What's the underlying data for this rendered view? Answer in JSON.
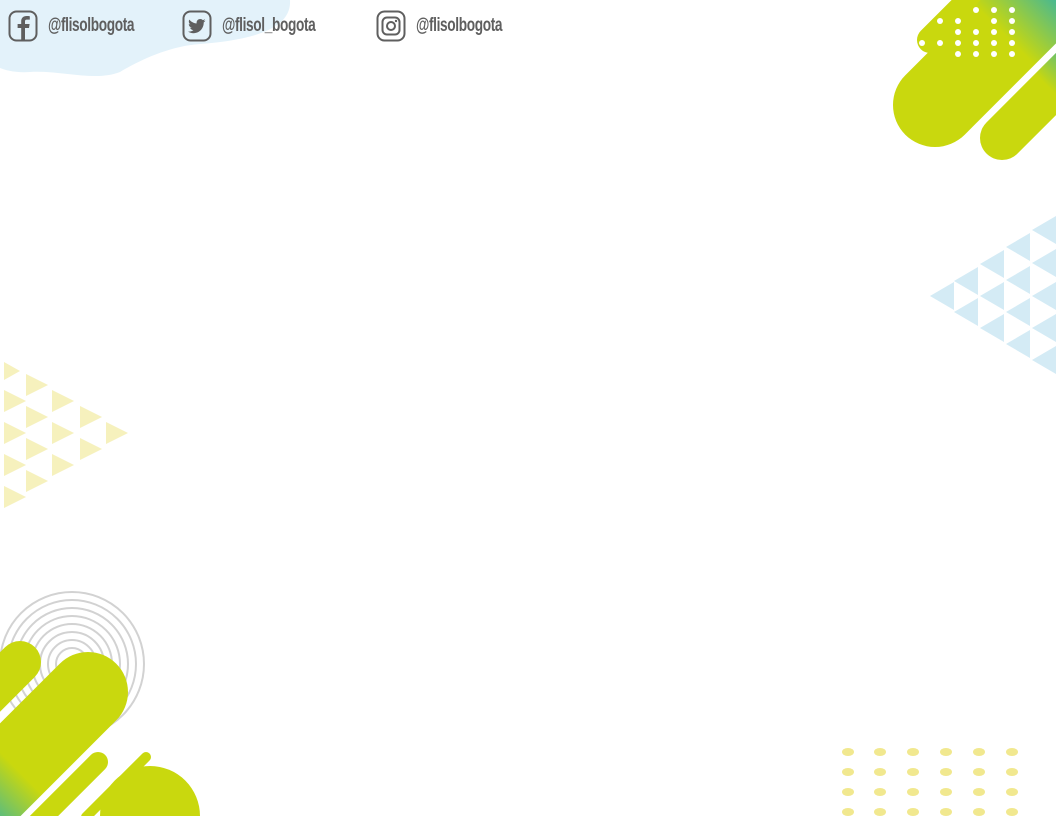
{
  "social": {
    "facebook": {
      "icon": "facebook-icon",
      "handle": "@flisolbogota"
    },
    "twitter": {
      "icon": "twitter-icon",
      "handle": "@flisol_bogota"
    },
    "instagram": {
      "icon": "instagram-icon",
      "handle": "@flisolbogota"
    }
  },
  "colors": {
    "lime": "#c6d61a",
    "teal": "#4ab89c",
    "blue": "#1a9fd6",
    "light_blue": "#d3ecf7",
    "pale_yellow": "#f5f0b8",
    "yellow_dots": "#f1e68c",
    "gray_rings": "#cfcfcf",
    "text_gray": "#5f5f5f"
  }
}
